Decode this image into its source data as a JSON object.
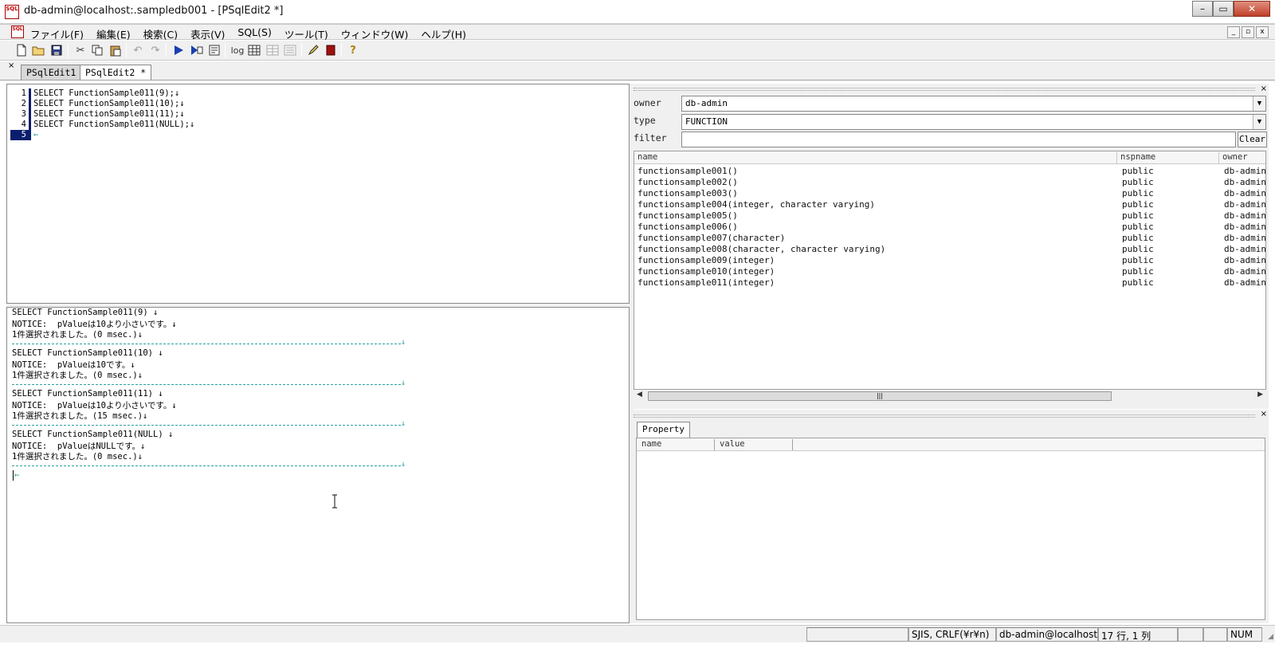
{
  "window": {
    "title": "db-admin@localhost:.sampledb001 - [PSqlEdit2 *]",
    "app_icon_text": "SQL",
    "min_label": "–",
    "max_label": "▭",
    "close_label": "✕"
  },
  "menu": {
    "items": [
      {
        "label": "ファイル(F)"
      },
      {
        "label": "編集(E)"
      },
      {
        "label": "検索(C)"
      },
      {
        "label": "表示(V)"
      },
      {
        "label": "SQL(S)"
      },
      {
        "label": "ツール(T)"
      },
      {
        "label": "ウィンドウ(W)"
      },
      {
        "label": "ヘルプ(H)"
      }
    ],
    "mdi_min": "_",
    "mdi_restore": "▫",
    "mdi_close": "x"
  },
  "toolbar": {
    "log_label": "log"
  },
  "tabs": {
    "close_glyph": "×",
    "items": [
      {
        "label": "PSqlEdit1 *"
      },
      {
        "label": "PSqlEdit2 *"
      }
    ]
  },
  "editor": {
    "lines": [
      {
        "num": "1",
        "code": "SELECT FunctionSample011(9);↓"
      },
      {
        "num": "2",
        "code": "SELECT FunctionSample011(10);↓"
      },
      {
        "num": "3",
        "code": "SELECT FunctionSample011(11);↓"
      },
      {
        "num": "4",
        "code": "SELECT FunctionSample011(NULL);↓"
      },
      {
        "num": "5",
        "code": "←"
      }
    ]
  },
  "output": {
    "blocks": [
      {
        "query": "SELECT FunctionSample011(9) ↓",
        "notice": "NOTICE:  pValueは10より小さいです。↓",
        "result": "1件選択されました。(0 msec.)↓"
      },
      {
        "query": "SELECT FunctionSample011(10) ↓",
        "notice": "NOTICE:  pValueは10です。↓",
        "result": "1件選択されました。(0 msec.)↓"
      },
      {
        "query": "SELECT FunctionSample011(11) ↓",
        "notice": "NOTICE:  pValueは10より小さいです。↓",
        "result": "1件選択されました。(15 msec.)↓"
      },
      {
        "query": "SELECT FunctionSample011(NULL) ↓",
        "notice": "NOTICE:  pValueはNULLです。↓",
        "result": "1件選択されました。(0 msec.)↓"
      }
    ],
    "separator_end": "↓",
    "last_line": "←"
  },
  "browser": {
    "owner_label": "owner",
    "owner_value": "db-admin",
    "type_label": "type",
    "type_value": "FUNCTION",
    "filter_label": "filter",
    "filter_value": "",
    "clear_label": "Clear",
    "close_glyph": "×",
    "columns": {
      "name": "name",
      "nspname": "nspname",
      "owner": "owner"
    },
    "rows": [
      {
        "name": "functionsample001()",
        "nspname": "public",
        "owner": "db-admin"
      },
      {
        "name": "functionsample002()",
        "nspname": "public",
        "owner": "db-admin"
      },
      {
        "name": "functionsample003()",
        "nspname": "public",
        "owner": "db-admin"
      },
      {
        "name": "functionsample004(integer, character varying)",
        "nspname": "public",
        "owner": "db-admin"
      },
      {
        "name": "functionsample005()",
        "nspname": "public",
        "owner": "db-admin"
      },
      {
        "name": "functionsample006()",
        "nspname": "public",
        "owner": "db-admin"
      },
      {
        "name": "functionsample007(character)",
        "nspname": "public",
        "owner": "db-admin"
      },
      {
        "name": "functionsample008(character, character varying)",
        "nspname": "public",
        "owner": "db-admin"
      },
      {
        "name": "functionsample009(integer)",
        "nspname": "public",
        "owner": "db-admin"
      },
      {
        "name": "functionsample010(integer)",
        "nspname": "public",
        "owner": "db-admin"
      },
      {
        "name": "functionsample011(integer)",
        "nspname": "public",
        "owner": "db-admin"
      }
    ],
    "scroll_thumb_glyph": "|||"
  },
  "property": {
    "tab_label": "Property",
    "close_glyph": "×",
    "columns": {
      "name": "name",
      "value": "value"
    }
  },
  "statusbar": {
    "encoding": "SJIS, CRLF(¥r¥n)",
    "connection": "db-admin@localhost:",
    "position": "17 行, 1 列",
    "num": "NUM"
  },
  "colors": {
    "line_number_bar": "#0a1e6e",
    "newline_marker": "#2aa0a0",
    "chrome_bg": "#f0f0f0"
  }
}
